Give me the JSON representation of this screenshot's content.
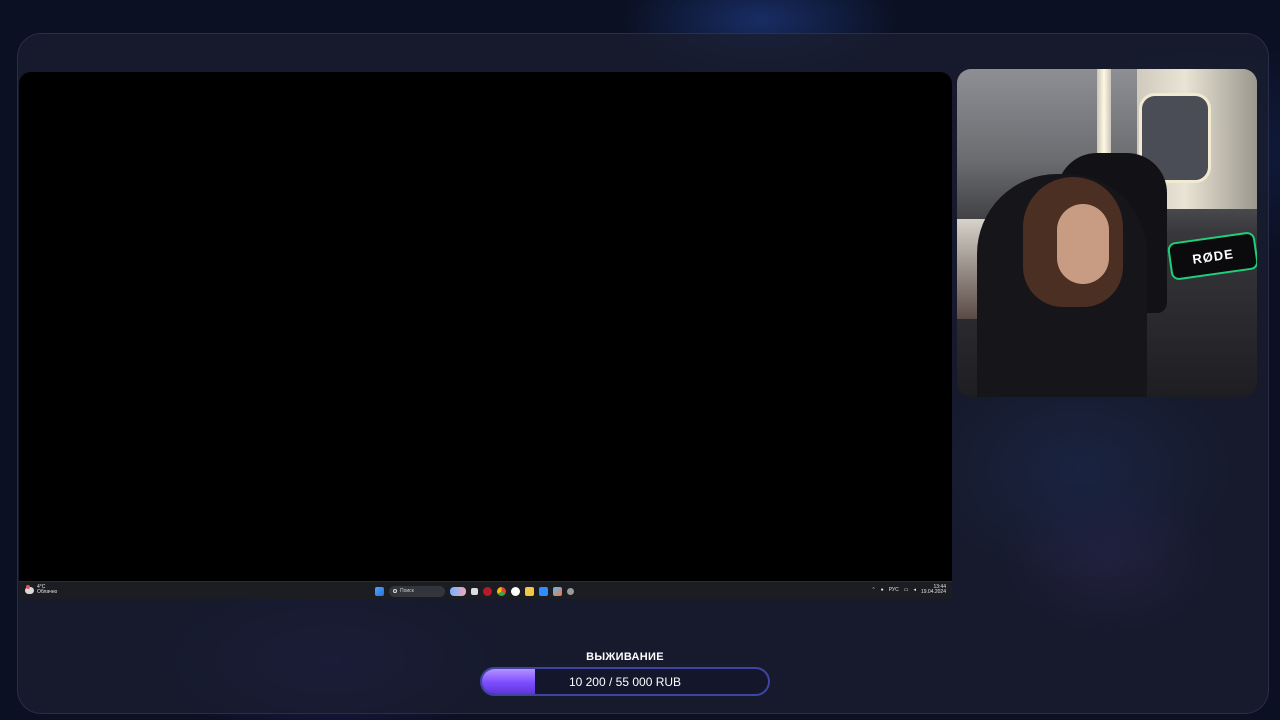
{
  "taskbar": {
    "weather_temp": "4°C",
    "weather_desc": "Облачно",
    "search_placeholder": "Поиск",
    "lang": "РУС",
    "time": "13:44",
    "date": "19.04.2024",
    "pinned_icons": [
      "windows-start-icon",
      "search-icon",
      "widgets-icon",
      "task-view-icon",
      "opera-icon",
      "chrome-icon",
      "yandex-icon",
      "folder-icon",
      "check-icon",
      "store-icon",
      "settings-icon"
    ]
  },
  "webcam": {
    "mic_label": "RØDE"
  },
  "goal": {
    "title": "ВЫЖИВАНИЕ",
    "text": "10 200 / 55 000 RUB",
    "current": 10200,
    "target": 55000,
    "fill_fraction": 0.185,
    "fill_color": "#7c4dff",
    "bar_bg": "#14172c"
  }
}
